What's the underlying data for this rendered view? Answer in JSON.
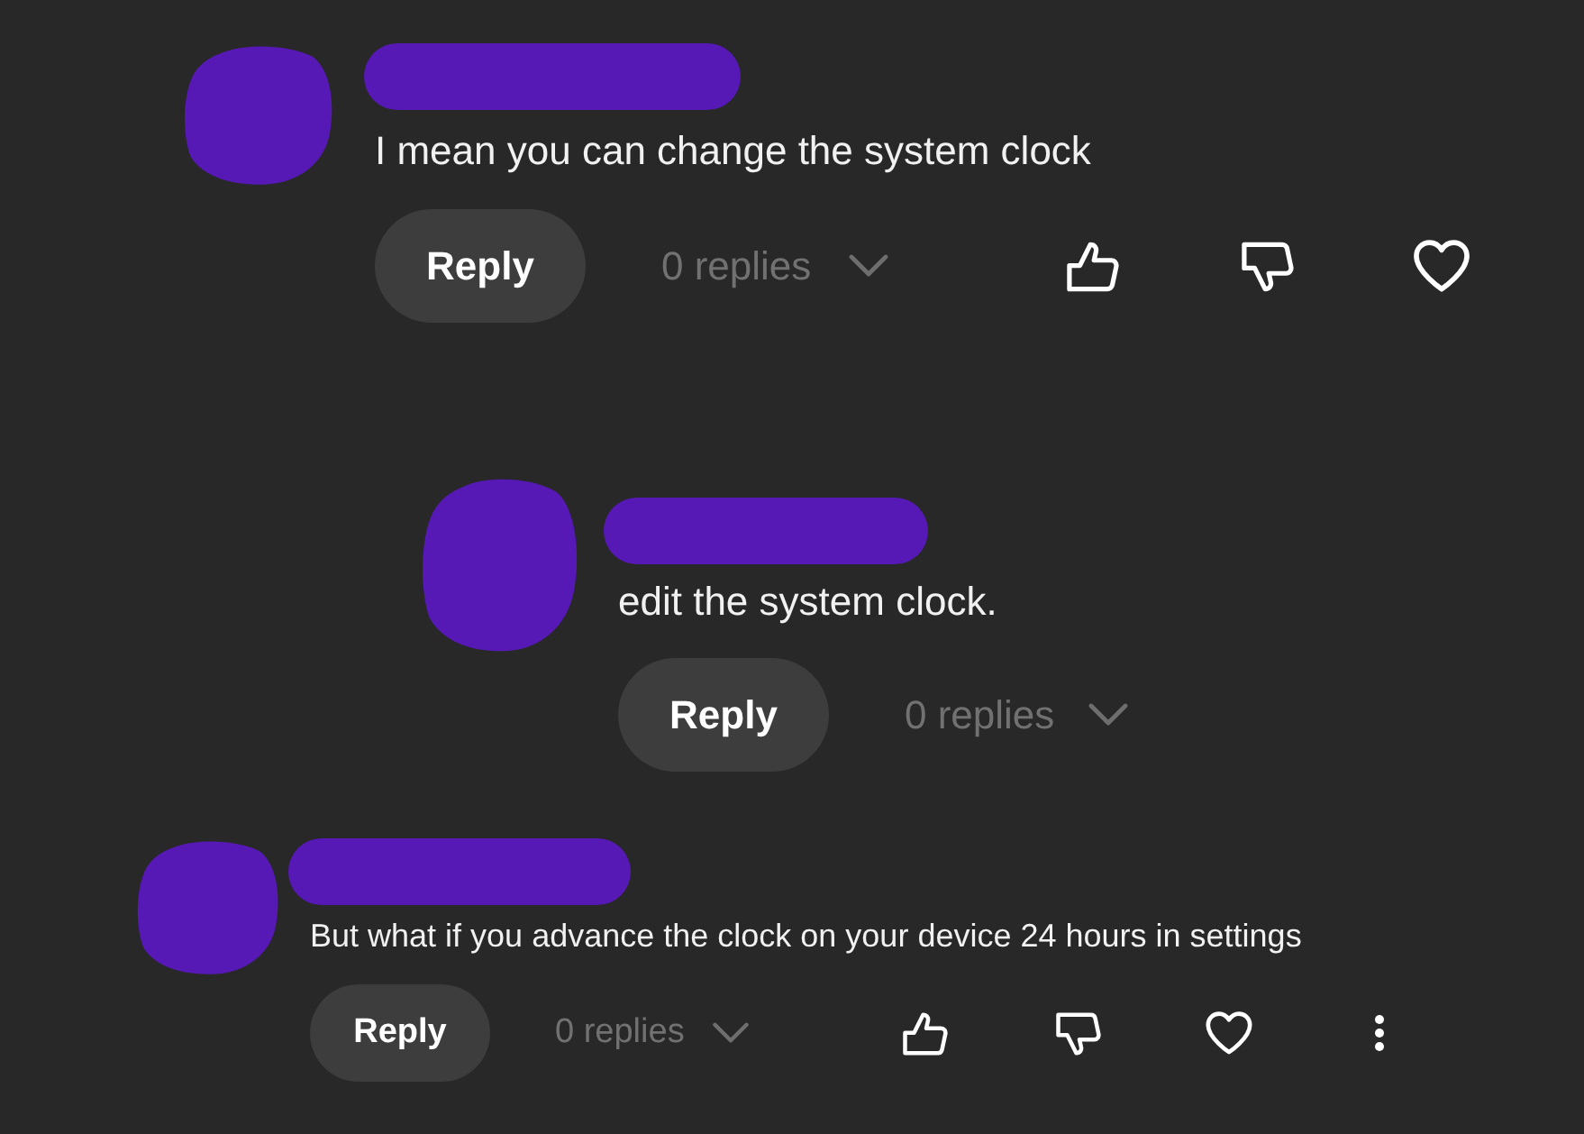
{
  "comments": [
    {
      "kind": "top",
      "text": "I mean you can change the system clock",
      "reply_button": "Reply",
      "replies": {
        "label": "0 replies",
        "expanded": false
      }
    },
    {
      "kind": "reply",
      "text": "edit the system clock.",
      "reply_button": "Reply",
      "replies": {
        "label": "0 replies",
        "expanded": false
      }
    },
    {
      "kind": "compact",
      "text": "But what if you advance the clock on your device 24 hours in settings",
      "reply_button": "Reply",
      "replies": {
        "label": "0 replies",
        "expanded": false
      }
    }
  ]
}
